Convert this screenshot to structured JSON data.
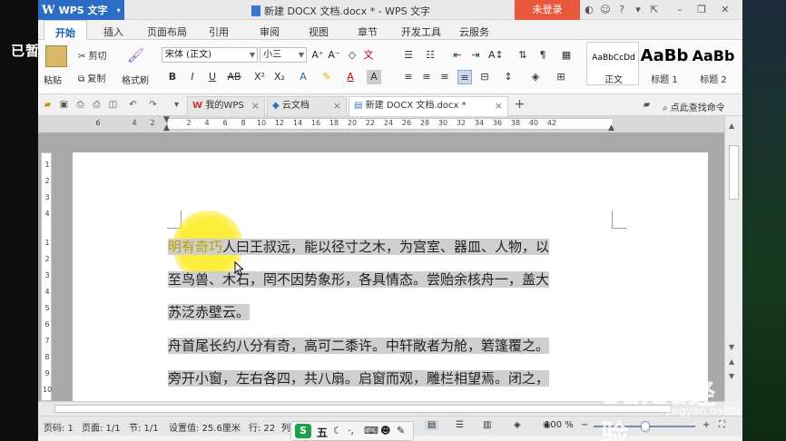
{
  "overlay": {
    "paused_label": "已暂停"
  },
  "titlebar": {
    "app_name": "WPS 文字",
    "document_title": "新建 DOCX 文档.docx * - WPS 文字",
    "login_label": "未登录"
  },
  "menu": {
    "tabs": [
      "开始",
      "插入",
      "页面布局",
      "引用",
      "审阅",
      "视图",
      "章节",
      "开发工具",
      "云服务"
    ]
  },
  "ribbon": {
    "paste_label": "粘贴",
    "cut_label": "剪切",
    "copy_label": "复制",
    "format_painter_label": "格式刷",
    "font_name": "宋体 (正文)",
    "font_size": "小三",
    "styles": [
      {
        "sample": "AaBbCcDd",
        "name": "正文"
      },
      {
        "sample": "AaBb",
        "name": "标题 1"
      },
      {
        "sample": "AaBb",
        "name": "标题 2"
      }
    ]
  },
  "doc_tabs": [
    {
      "label": "我的WPS"
    },
    {
      "label": "云文档"
    },
    {
      "label": "新建 DOCX 文档.docx *"
    }
  ],
  "search": {
    "label": "点此查找命令"
  },
  "ruler": {
    "h_numbers": [
      "6",
      "4",
      "2",
      "",
      "2",
      "4",
      "6",
      "8",
      "10",
      "12",
      "14",
      "16",
      "18",
      "20",
      "22",
      "24",
      "26",
      "28",
      "30",
      "32",
      "34",
      "36",
      "38",
      "40",
      "42"
    ],
    "v_numbers": [
      "1",
      "2",
      "3",
      "4",
      "1",
      "1",
      "2",
      "3",
      "4",
      "5",
      "6",
      "7",
      "8",
      "9",
      "10"
    ]
  },
  "document": {
    "lines": [
      {
        "pre": "明有奇巧",
        "text": "人曰王叔远，能以径寸之木，为宫室、器皿、人物，以"
      },
      {
        "pre": "",
        "text": "至鸟兽、木石，罔不因势象形，各具情态。尝贻余核舟一，盖大"
      },
      {
        "pre": "",
        "text": "苏泛赤壁云。"
      },
      {
        "pre": "",
        "text": "舟首尾长约八分有奇，高可二黍许。中轩敞者为舱，箬篷覆之。"
      },
      {
        "pre": "",
        "text": "旁开小窗，左右各四，共八扇。启窗而观，雕栏相望焉。闭之，"
      }
    ]
  },
  "statusbar": {
    "page_num": "页码: 1",
    "pages": "页面: 1/1",
    "section": "节: 1/1",
    "setting": "设置值: 25.6厘米",
    "row": "行: 22",
    "col": "列",
    "zoom": "100 %"
  },
  "ime": {
    "label": "五"
  },
  "watermark": {
    "brand": "Baidu经验",
    "url": "jingyan.baidu.com"
  },
  "colors": {
    "accent": "#2b6cc4",
    "login": "#e8583a",
    "highlight": "#cfcfcf",
    "cursor_spot": "#ffec32"
  }
}
